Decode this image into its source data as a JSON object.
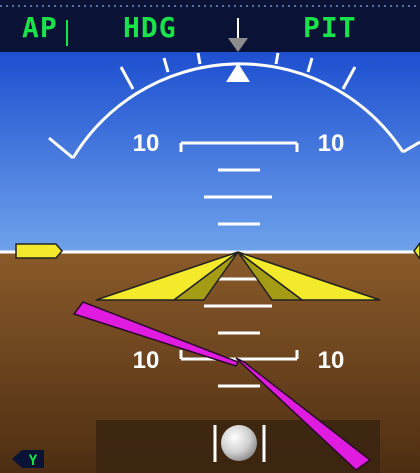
{
  "annunciator": {
    "autopilot": "AP",
    "lateral_mode": "HDG",
    "vertical_mode": "PIT"
  },
  "pitch_ladder": {
    "upper_left": "10",
    "upper_right": "10",
    "lower_left": "10",
    "lower_right": "10"
  },
  "yaw_damper": "Y",
  "colors": {
    "sky_top": "#1d4fd0",
    "sky_bottom": "#6fa2ea",
    "ground_top": "#8a5a2a",
    "ground_bottom": "#4d2e12",
    "annunciator_green": "#19e34a",
    "annunciator_bg": "#0a1235",
    "aircraft_symbol": "#f2ea2a",
    "flight_director": "#e01ce0",
    "scale_white": "#ffffff"
  },
  "icons": [
    "roll-pointer-icon",
    "aircraft-symbol-icon",
    "flight-director-icon",
    "slip-skid-ball-icon",
    "yaw-damper-icon"
  ]
}
